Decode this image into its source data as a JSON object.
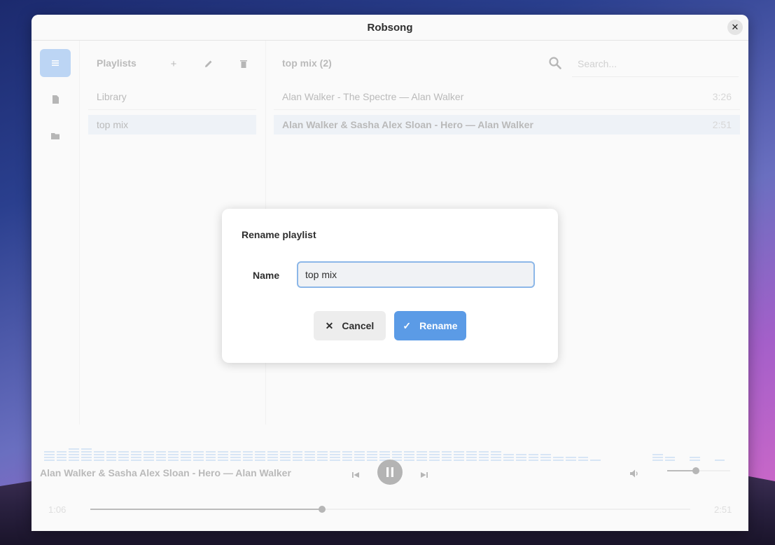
{
  "window": {
    "title": "Robsong"
  },
  "rail": {
    "items": [
      {
        "name": "playlists-view",
        "icon": "list-icon"
      },
      {
        "name": "file",
        "icon": "file-icon"
      },
      {
        "name": "folder",
        "icon": "folder-icon"
      }
    ]
  },
  "playlists": {
    "header": "Playlists",
    "items": [
      "Library",
      "top mix"
    ],
    "selected": 1
  },
  "tracks": {
    "header": "top mix (2)",
    "search_placeholder": "Search...",
    "rows": [
      {
        "title": "Alan Walker - The Spectre  —  Alan Walker",
        "duration": "3:26"
      },
      {
        "title": "Alan Walker & Sasha Alex Sloan - Hero  —  Alan Walker",
        "duration": "2:51"
      }
    ],
    "selected": 1
  },
  "player": {
    "now_playing": "Alan Walker & Sasha Alex Sloan - Hero  —  Alan Walker",
    "elapsed": "1:06",
    "total": "2:51",
    "progress_fraction": 0.386,
    "volume_fraction": 0.45,
    "state": "playing"
  },
  "visualizer": {
    "levels": [
      4,
      4,
      5,
      5,
      4,
      4,
      4,
      4,
      4,
      4,
      4,
      4,
      4,
      4,
      4,
      4,
      4,
      4,
      4,
      4,
      4,
      4,
      4,
      4,
      4,
      4,
      4,
      4,
      4,
      4,
      4,
      4,
      4,
      4,
      4,
      4,
      4,
      3,
      3,
      3,
      3,
      2,
      2,
      2,
      1,
      0,
      0,
      0,
      0,
      3,
      2,
      0,
      2,
      0,
      1,
      0
    ]
  },
  "dialog": {
    "title": "Rename playlist",
    "name_label": "Name",
    "name_value": "top mix",
    "cancel_label": "Cancel",
    "rename_label": "Rename"
  },
  "colors": {
    "accent": "#3584e4",
    "selection": "#d3dff0",
    "rename_button": "#5b9be6"
  }
}
